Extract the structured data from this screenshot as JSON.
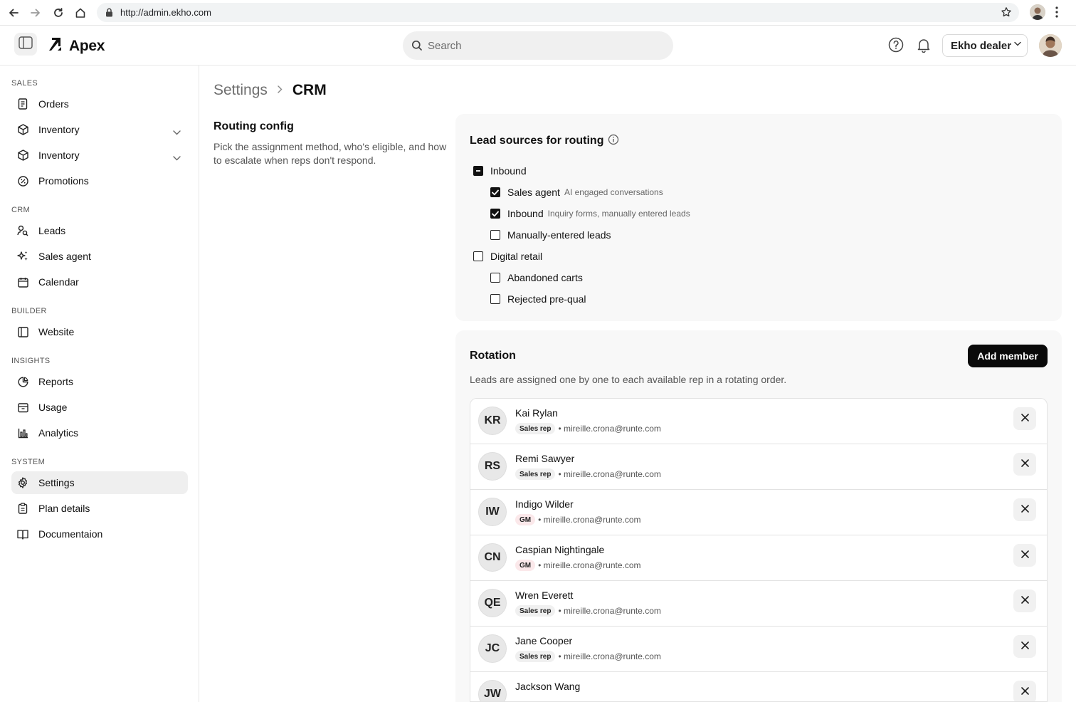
{
  "browser": {
    "url": "http://admin.ekho.com"
  },
  "header": {
    "logo_text": "Apex",
    "search_placeholder": "Search",
    "dealer_label": "Ekho dealer"
  },
  "sidebar": {
    "sections": {
      "sales": "SALES",
      "crm": "CRM",
      "builder": "BUILDER",
      "insights": "INSIGHTS",
      "system": "SYSTEM"
    },
    "items": {
      "orders": "Orders",
      "inventory_1": "Inventory",
      "inventory_2": "Inventory",
      "promotions": "Promotions",
      "leads": "Leads",
      "sales_agent": "Sales agent",
      "calendar": "Calendar",
      "website": "Website",
      "reports": "Reports",
      "usage": "Usage",
      "analytics": "Analytics",
      "settings": "Settings",
      "plan_details": "Plan details",
      "documentation": "Documentaion"
    },
    "active_item": "Settings"
  },
  "breadcrumb": {
    "parent": "Settings",
    "current": "CRM"
  },
  "routing": {
    "title": "Routing config",
    "description": "Pick the assignment method, who's eligible, and how to escalate when reps don't respond."
  },
  "lead_sources": {
    "title": "Lead sources for routing",
    "items": [
      {
        "label": "Inbound",
        "sub": "",
        "state": "indeterminate"
      },
      {
        "label": "Sales agent",
        "sub": "AI engaged conversations",
        "state": "checked"
      },
      {
        "label": "Inbound",
        "sub": "Inquiry forms, manually entered leads",
        "state": "checked"
      },
      {
        "label": "Manually-entered leads",
        "sub": "",
        "state": "unchecked"
      },
      {
        "label": "Digital retail",
        "sub": "",
        "state": "unchecked"
      },
      {
        "label": "Abandoned carts",
        "sub": "",
        "state": "unchecked"
      },
      {
        "label": "Rejected pre-qual",
        "sub": "",
        "state": "unchecked"
      }
    ]
  },
  "rotation": {
    "title": "Rotation",
    "add_member_label": "Add member",
    "description": "Leads are assigned one by one to each available rep in a rotating order.",
    "members": [
      {
        "initials": "KR",
        "name": "Kai Rylan",
        "role": "Sales rep",
        "email": "• mireille.crona@runte.com"
      },
      {
        "initials": "RS",
        "name": "Remi Sawyer",
        "role": "Sales rep",
        "email": "• mireille.crona@runte.com"
      },
      {
        "initials": "IW",
        "name": "Indigo Wilder",
        "role": "GM",
        "email": "• mireille.crona@runte.com"
      },
      {
        "initials": "CN",
        "name": "Caspian Nightingale",
        "role": "GM",
        "email": "• mireille.crona@runte.com"
      },
      {
        "initials": "QE",
        "name": "Wren Everett",
        "role": "Sales rep",
        "email": "• mireille.crona@runte.com"
      },
      {
        "initials": "JC",
        "name": "Jane Cooper",
        "role": "Sales rep",
        "email": "• mireille.crona@runte.com"
      },
      {
        "initials": "JW",
        "name": "Jackson Wang",
        "role": "",
        "email": ""
      }
    ]
  }
}
